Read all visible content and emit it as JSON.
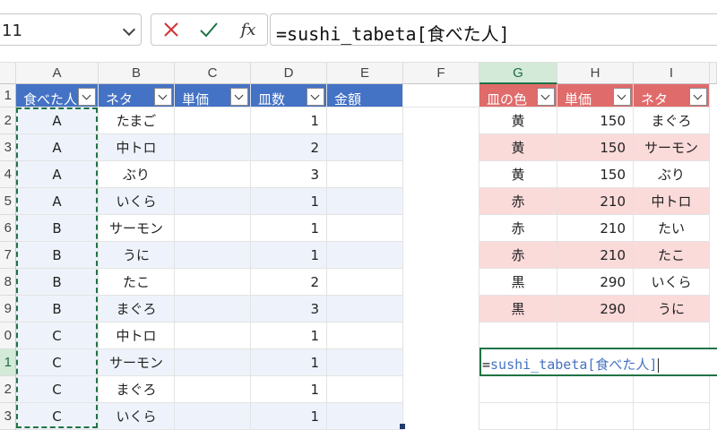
{
  "formula_bar": {
    "name_box": "11",
    "cancel_icon": "close-icon",
    "enter_icon": "checkmark-icon",
    "fx_label": "fx",
    "formula": "=sushi_tabeta[食べた人]"
  },
  "columns": [
    "A",
    "B",
    "C",
    "D",
    "E",
    "F",
    "G",
    "H",
    "I"
  ],
  "rows": [
    "1",
    "2",
    "3",
    "4",
    "5",
    "6",
    "7",
    "8",
    "9",
    "0",
    "1",
    "2",
    "3"
  ],
  "table1": {
    "headers": [
      "食べた人",
      "ネタ",
      "単価",
      "皿数",
      "金額"
    ],
    "rows": [
      [
        "A",
        "たまご",
        "",
        "1",
        ""
      ],
      [
        "A",
        "中トロ",
        "",
        "2",
        ""
      ],
      [
        "A",
        "ぶり",
        "",
        "3",
        ""
      ],
      [
        "A",
        "いくら",
        "",
        "1",
        ""
      ],
      [
        "B",
        "サーモン",
        "",
        "1",
        ""
      ],
      [
        "B",
        "うに",
        "",
        "1",
        ""
      ],
      [
        "B",
        "たこ",
        "",
        "2",
        ""
      ],
      [
        "B",
        "まぐろ",
        "",
        "3",
        ""
      ],
      [
        "C",
        "中トロ",
        "",
        "1",
        ""
      ],
      [
        "C",
        "サーモン",
        "",
        "1",
        ""
      ],
      [
        "C",
        "まぐろ",
        "",
        "1",
        ""
      ],
      [
        "C",
        "いくら",
        "",
        "1",
        ""
      ]
    ]
  },
  "table2": {
    "headers": [
      "皿の色",
      "単価",
      "ネタ"
    ],
    "rows": [
      [
        "黄",
        "150",
        "まぐろ"
      ],
      [
        "黄",
        "150",
        "サーモン"
      ],
      [
        "黄",
        "150",
        "ぶり"
      ],
      [
        "赤",
        "210",
        "中トロ"
      ],
      [
        "赤",
        "210",
        "たい"
      ],
      [
        "赤",
        "210",
        "たこ"
      ],
      [
        "黒",
        "290",
        "いくら"
      ],
      [
        "黒",
        "290",
        "うに"
      ]
    ]
  },
  "active_cell": {
    "eq": "=",
    "ref": "sushi_tabeta[食べた人]"
  },
  "colors": {
    "table1_header": "#4472c4",
    "table2_header": "#e06b6b",
    "selection": "#217346"
  }
}
